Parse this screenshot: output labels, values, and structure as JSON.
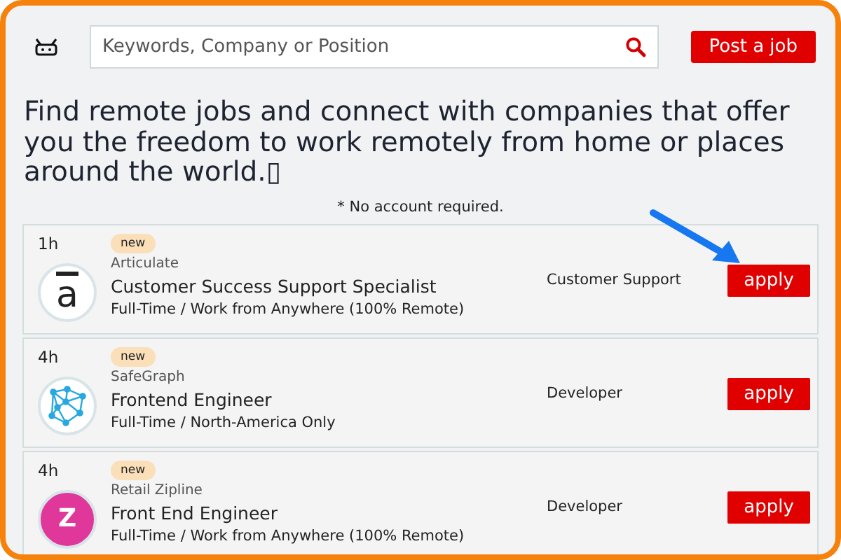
{
  "header": {
    "search": {
      "placeholder": "Keywords, Company or Position"
    },
    "post_button": "Post a job"
  },
  "headline": "Find remote jobs and connect with companies that offer you the freedom to work remotely from home or places around the world.▯",
  "note": "* No account required.",
  "jobs": [
    {
      "age": "1h",
      "badge": "new",
      "company": "Articulate",
      "title": "Customer Success Support Specialist",
      "terms": "Full-Time / Work from Anywhere (100% Remote)",
      "category": "Customer Support",
      "apply": "apply",
      "logo": {
        "kind": "letter",
        "text": "a",
        "color": "#ffffff"
      }
    },
    {
      "age": "4h",
      "badge": "new",
      "company": "SafeGraph",
      "title": "Frontend Engineer",
      "terms": "Full-Time / North-America Only",
      "category": "Developer",
      "apply": "apply",
      "logo": {
        "kind": "network",
        "color": "#ffffff"
      }
    },
    {
      "age": "4h",
      "badge": "new",
      "company": "Retail Zipline",
      "title": "Front End Engineer",
      "terms": "Full-Time / Work from Anywhere (100% Remote)",
      "category": "Developer",
      "apply": "apply",
      "logo": {
        "kind": "letter",
        "text": "Z",
        "color": "#e0379a"
      }
    }
  ]
}
